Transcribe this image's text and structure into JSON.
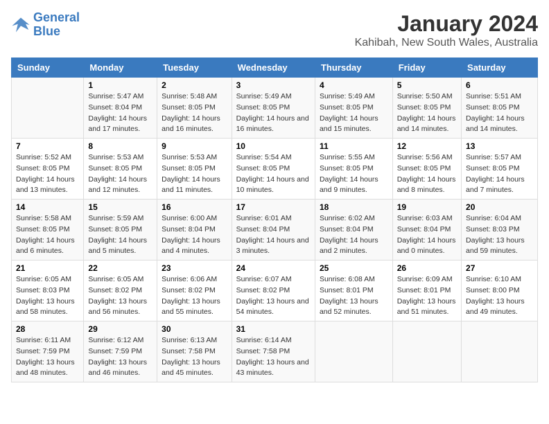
{
  "logo": {
    "line1": "General",
    "line2": "Blue"
  },
  "title": "January 2024",
  "subtitle": "Kahibah, New South Wales, Australia",
  "days_of_week": [
    "Sunday",
    "Monday",
    "Tuesday",
    "Wednesday",
    "Thursday",
    "Friday",
    "Saturday"
  ],
  "weeks": [
    [
      {
        "day": "",
        "sunrise": "",
        "sunset": "",
        "daylight": ""
      },
      {
        "day": "1",
        "sunrise": "Sunrise: 5:47 AM",
        "sunset": "Sunset: 8:04 PM",
        "daylight": "Daylight: 14 hours and 17 minutes."
      },
      {
        "day": "2",
        "sunrise": "Sunrise: 5:48 AM",
        "sunset": "Sunset: 8:05 PM",
        "daylight": "Daylight: 14 hours and 16 minutes."
      },
      {
        "day": "3",
        "sunrise": "Sunrise: 5:49 AM",
        "sunset": "Sunset: 8:05 PM",
        "daylight": "Daylight: 14 hours and 16 minutes."
      },
      {
        "day": "4",
        "sunrise": "Sunrise: 5:49 AM",
        "sunset": "Sunset: 8:05 PM",
        "daylight": "Daylight: 14 hours and 15 minutes."
      },
      {
        "day": "5",
        "sunrise": "Sunrise: 5:50 AM",
        "sunset": "Sunset: 8:05 PM",
        "daylight": "Daylight: 14 hours and 14 minutes."
      },
      {
        "day": "6",
        "sunrise": "Sunrise: 5:51 AM",
        "sunset": "Sunset: 8:05 PM",
        "daylight": "Daylight: 14 hours and 14 minutes."
      }
    ],
    [
      {
        "day": "7",
        "sunrise": "Sunrise: 5:52 AM",
        "sunset": "Sunset: 8:05 PM",
        "daylight": "Daylight: 14 hours and 13 minutes."
      },
      {
        "day": "8",
        "sunrise": "Sunrise: 5:53 AM",
        "sunset": "Sunset: 8:05 PM",
        "daylight": "Daylight: 14 hours and 12 minutes."
      },
      {
        "day": "9",
        "sunrise": "Sunrise: 5:53 AM",
        "sunset": "Sunset: 8:05 PM",
        "daylight": "Daylight: 14 hours and 11 minutes."
      },
      {
        "day": "10",
        "sunrise": "Sunrise: 5:54 AM",
        "sunset": "Sunset: 8:05 PM",
        "daylight": "Daylight: 14 hours and 10 minutes."
      },
      {
        "day": "11",
        "sunrise": "Sunrise: 5:55 AM",
        "sunset": "Sunset: 8:05 PM",
        "daylight": "Daylight: 14 hours and 9 minutes."
      },
      {
        "day": "12",
        "sunrise": "Sunrise: 5:56 AM",
        "sunset": "Sunset: 8:05 PM",
        "daylight": "Daylight: 14 hours and 8 minutes."
      },
      {
        "day": "13",
        "sunrise": "Sunrise: 5:57 AM",
        "sunset": "Sunset: 8:05 PM",
        "daylight": "Daylight: 14 hours and 7 minutes."
      }
    ],
    [
      {
        "day": "14",
        "sunrise": "Sunrise: 5:58 AM",
        "sunset": "Sunset: 8:05 PM",
        "daylight": "Daylight: 14 hours and 6 minutes."
      },
      {
        "day": "15",
        "sunrise": "Sunrise: 5:59 AM",
        "sunset": "Sunset: 8:05 PM",
        "daylight": "Daylight: 14 hours and 5 minutes."
      },
      {
        "day": "16",
        "sunrise": "Sunrise: 6:00 AM",
        "sunset": "Sunset: 8:04 PM",
        "daylight": "Daylight: 14 hours and 4 minutes."
      },
      {
        "day": "17",
        "sunrise": "Sunrise: 6:01 AM",
        "sunset": "Sunset: 8:04 PM",
        "daylight": "Daylight: 14 hours and 3 minutes."
      },
      {
        "day": "18",
        "sunrise": "Sunrise: 6:02 AM",
        "sunset": "Sunset: 8:04 PM",
        "daylight": "Daylight: 14 hours and 2 minutes."
      },
      {
        "day": "19",
        "sunrise": "Sunrise: 6:03 AM",
        "sunset": "Sunset: 8:04 PM",
        "daylight": "Daylight: 14 hours and 0 minutes."
      },
      {
        "day": "20",
        "sunrise": "Sunrise: 6:04 AM",
        "sunset": "Sunset: 8:03 PM",
        "daylight": "Daylight: 13 hours and 59 minutes."
      }
    ],
    [
      {
        "day": "21",
        "sunrise": "Sunrise: 6:05 AM",
        "sunset": "Sunset: 8:03 PM",
        "daylight": "Daylight: 13 hours and 58 minutes."
      },
      {
        "day": "22",
        "sunrise": "Sunrise: 6:05 AM",
        "sunset": "Sunset: 8:02 PM",
        "daylight": "Daylight: 13 hours and 56 minutes."
      },
      {
        "day": "23",
        "sunrise": "Sunrise: 6:06 AM",
        "sunset": "Sunset: 8:02 PM",
        "daylight": "Daylight: 13 hours and 55 minutes."
      },
      {
        "day": "24",
        "sunrise": "Sunrise: 6:07 AM",
        "sunset": "Sunset: 8:02 PM",
        "daylight": "Daylight: 13 hours and 54 minutes."
      },
      {
        "day": "25",
        "sunrise": "Sunrise: 6:08 AM",
        "sunset": "Sunset: 8:01 PM",
        "daylight": "Daylight: 13 hours and 52 minutes."
      },
      {
        "day": "26",
        "sunrise": "Sunrise: 6:09 AM",
        "sunset": "Sunset: 8:01 PM",
        "daylight": "Daylight: 13 hours and 51 minutes."
      },
      {
        "day": "27",
        "sunrise": "Sunrise: 6:10 AM",
        "sunset": "Sunset: 8:00 PM",
        "daylight": "Daylight: 13 hours and 49 minutes."
      }
    ],
    [
      {
        "day": "28",
        "sunrise": "Sunrise: 6:11 AM",
        "sunset": "Sunset: 7:59 PM",
        "daylight": "Daylight: 13 hours and 48 minutes."
      },
      {
        "day": "29",
        "sunrise": "Sunrise: 6:12 AM",
        "sunset": "Sunset: 7:59 PM",
        "daylight": "Daylight: 13 hours and 46 minutes."
      },
      {
        "day": "30",
        "sunrise": "Sunrise: 6:13 AM",
        "sunset": "Sunset: 7:58 PM",
        "daylight": "Daylight: 13 hours and 45 minutes."
      },
      {
        "day": "31",
        "sunrise": "Sunrise: 6:14 AM",
        "sunset": "Sunset: 7:58 PM",
        "daylight": "Daylight: 13 hours and 43 minutes."
      },
      {
        "day": "",
        "sunrise": "",
        "sunset": "",
        "daylight": ""
      },
      {
        "day": "",
        "sunrise": "",
        "sunset": "",
        "daylight": ""
      },
      {
        "day": "",
        "sunrise": "",
        "sunset": "",
        "daylight": ""
      }
    ]
  ]
}
